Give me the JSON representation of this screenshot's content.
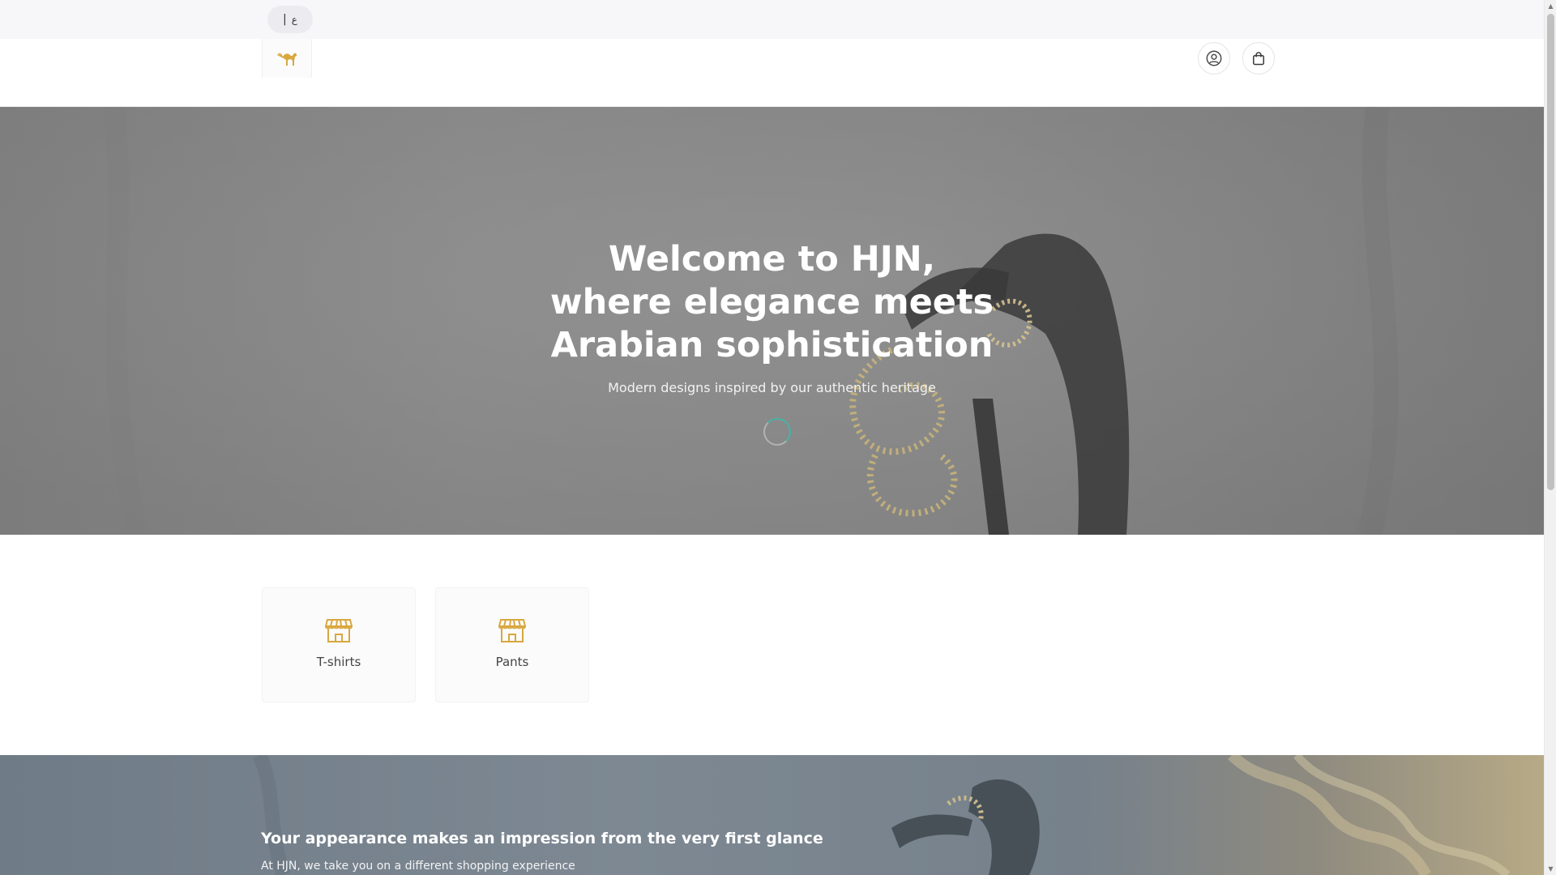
{
  "top_bar": {
    "language_toggle": {
      "separator": "|",
      "alternate_language_label": "ع"
    }
  },
  "header": {
    "logo_alt": "HJN camel logo",
    "account_icon": "user-circle-icon",
    "cart_icon": "shopping-bag-icon"
  },
  "hero": {
    "title": "Welcome to HJN, where elegance meets Arabian sophistication",
    "subtitle": "Modern designs inspired by our authentic heritage",
    "loading": true
  },
  "categories": [
    {
      "label": "T-shirts",
      "icon": "storefront-icon"
    },
    {
      "label": "Pants",
      "icon": "storefront-icon"
    }
  ],
  "banner": {
    "title": "Your appearance makes an impression from the very first glance",
    "text": "At HJN, we take you on a different shopping experience"
  },
  "colors": {
    "accent_gold": "#d9a73e",
    "spinner_teal": "#47b3a6",
    "hero_overlay": "#8a8a8a"
  }
}
